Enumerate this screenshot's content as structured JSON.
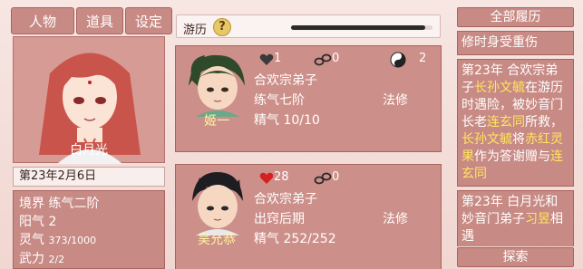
{
  "tabs": {
    "person": "人物",
    "items": "道具",
    "settings": "设定"
  },
  "player": {
    "name": "白月光",
    "date": "第23年2月6日",
    "realm": "境界 练气二阶",
    "yang": "阳气 2",
    "ling_label": "灵气",
    "ling_value": "373/1000",
    "wuli_label": "武力",
    "wuli_value": "2/2"
  },
  "travel": {
    "label": "游历",
    "help": "?",
    "progress": 0.95
  },
  "characters": [
    {
      "name": "姬一",
      "affection": "1",
      "affection_filled": false,
      "bond": "0",
      "yinyang": "2",
      "sect": "合欢宗弟子",
      "realm": "练气七阶",
      "path": "法修",
      "essence": "精气 10/10"
    },
    {
      "name": "吴允恭",
      "affection": "28",
      "affection_filled": true,
      "bond": "0",
      "yinyang": "",
      "sect": "合欢宗弟子",
      "realm": "出窍后期",
      "path": "法修",
      "essence": "精气 252/252"
    }
  ],
  "history": {
    "button": "全部履历",
    "entries": [
      {
        "parts": [
          {
            "t": "修时身受重伤",
            "h": false
          }
        ]
      },
      {
        "parts": [
          {
            "t": "第23年 合欢宗弟子",
            "h": false
          },
          {
            "t": "长孙文毓",
            "h": true
          },
          {
            "t": "在游历时遇险，被妙音门长老",
            "h": false
          },
          {
            "t": "连玄同",
            "h": true
          },
          {
            "t": "所救，",
            "h": false
          },
          {
            "t": "长孙文毓",
            "h": true
          },
          {
            "t": "将",
            "h": false
          },
          {
            "t": "赤红灵果",
            "h": true
          },
          {
            "t": "作为答谢赠与",
            "h": false
          },
          {
            "t": "连玄同",
            "h": true
          }
        ]
      },
      {
        "parts": [
          {
            "t": "第23年 白月光和妙音门弟子",
            "h": false
          },
          {
            "t": "习昱",
            "h": true
          },
          {
            "t": "相遇",
            "h": false
          }
        ]
      }
    ],
    "explore_button": "探索"
  },
  "colors": {
    "panel": "#c88a84",
    "highlight": "#ffe75e",
    "heart_empty": "#3a3a3a",
    "heart_filled": "#d42020"
  }
}
